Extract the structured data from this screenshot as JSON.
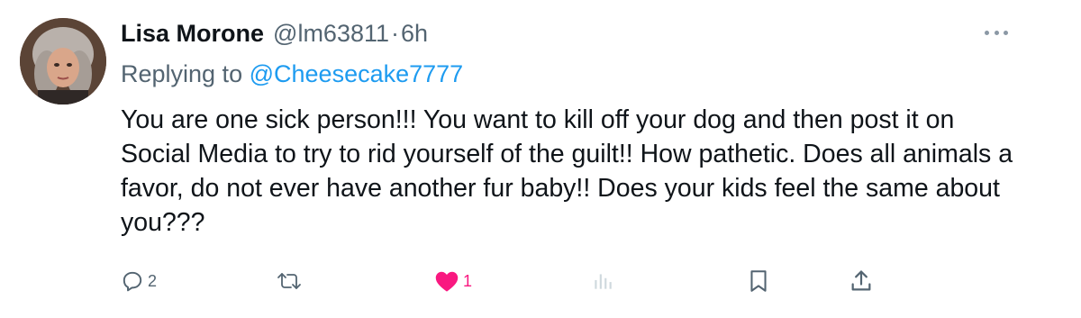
{
  "tweet": {
    "author_name": "Lisa Morone",
    "author_handle": "@lm63811",
    "separator": "·",
    "time": "6h",
    "replying_prefix": "Replying to",
    "replying_to": "@Cheesecake7777",
    "text": "You are one sick person!!! You want to kill off your dog and then post it on Social Media to try to rid yourself of the guilt!! How pathetic. Does all animals a favor, do not ever have another fur baby!! Does your kids feel the same about you???"
  },
  "actions": {
    "reply_count": "2",
    "like_count": "1"
  },
  "icons": {
    "reply": "reply-icon",
    "retweet": "retweet-icon",
    "like": "heart-icon",
    "views": "views-icon",
    "bookmark": "bookmark-icon",
    "share": "share-icon",
    "more": "more-icon"
  },
  "colors": {
    "text": "#0f1419",
    "secondary": "#536471",
    "link": "#1d9bf0",
    "like": "#f91880",
    "views_disabled": "#cfd9de"
  }
}
